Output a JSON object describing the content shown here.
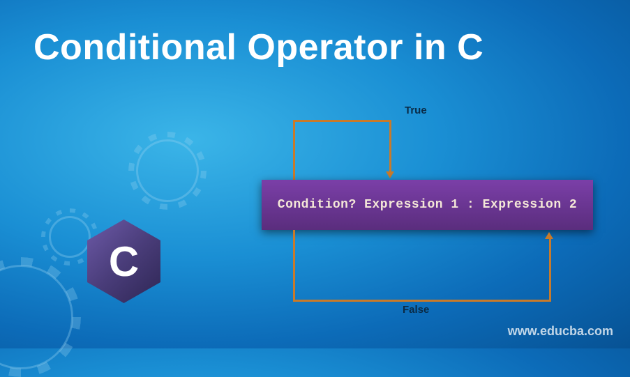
{
  "title": "Conditional Operator in C",
  "logo": {
    "letter": "C"
  },
  "diagram": {
    "true_label": "True",
    "false_label": "False",
    "expression": "Condition? Expression 1 : Expression 2"
  },
  "watermark": "www.educba.com"
}
